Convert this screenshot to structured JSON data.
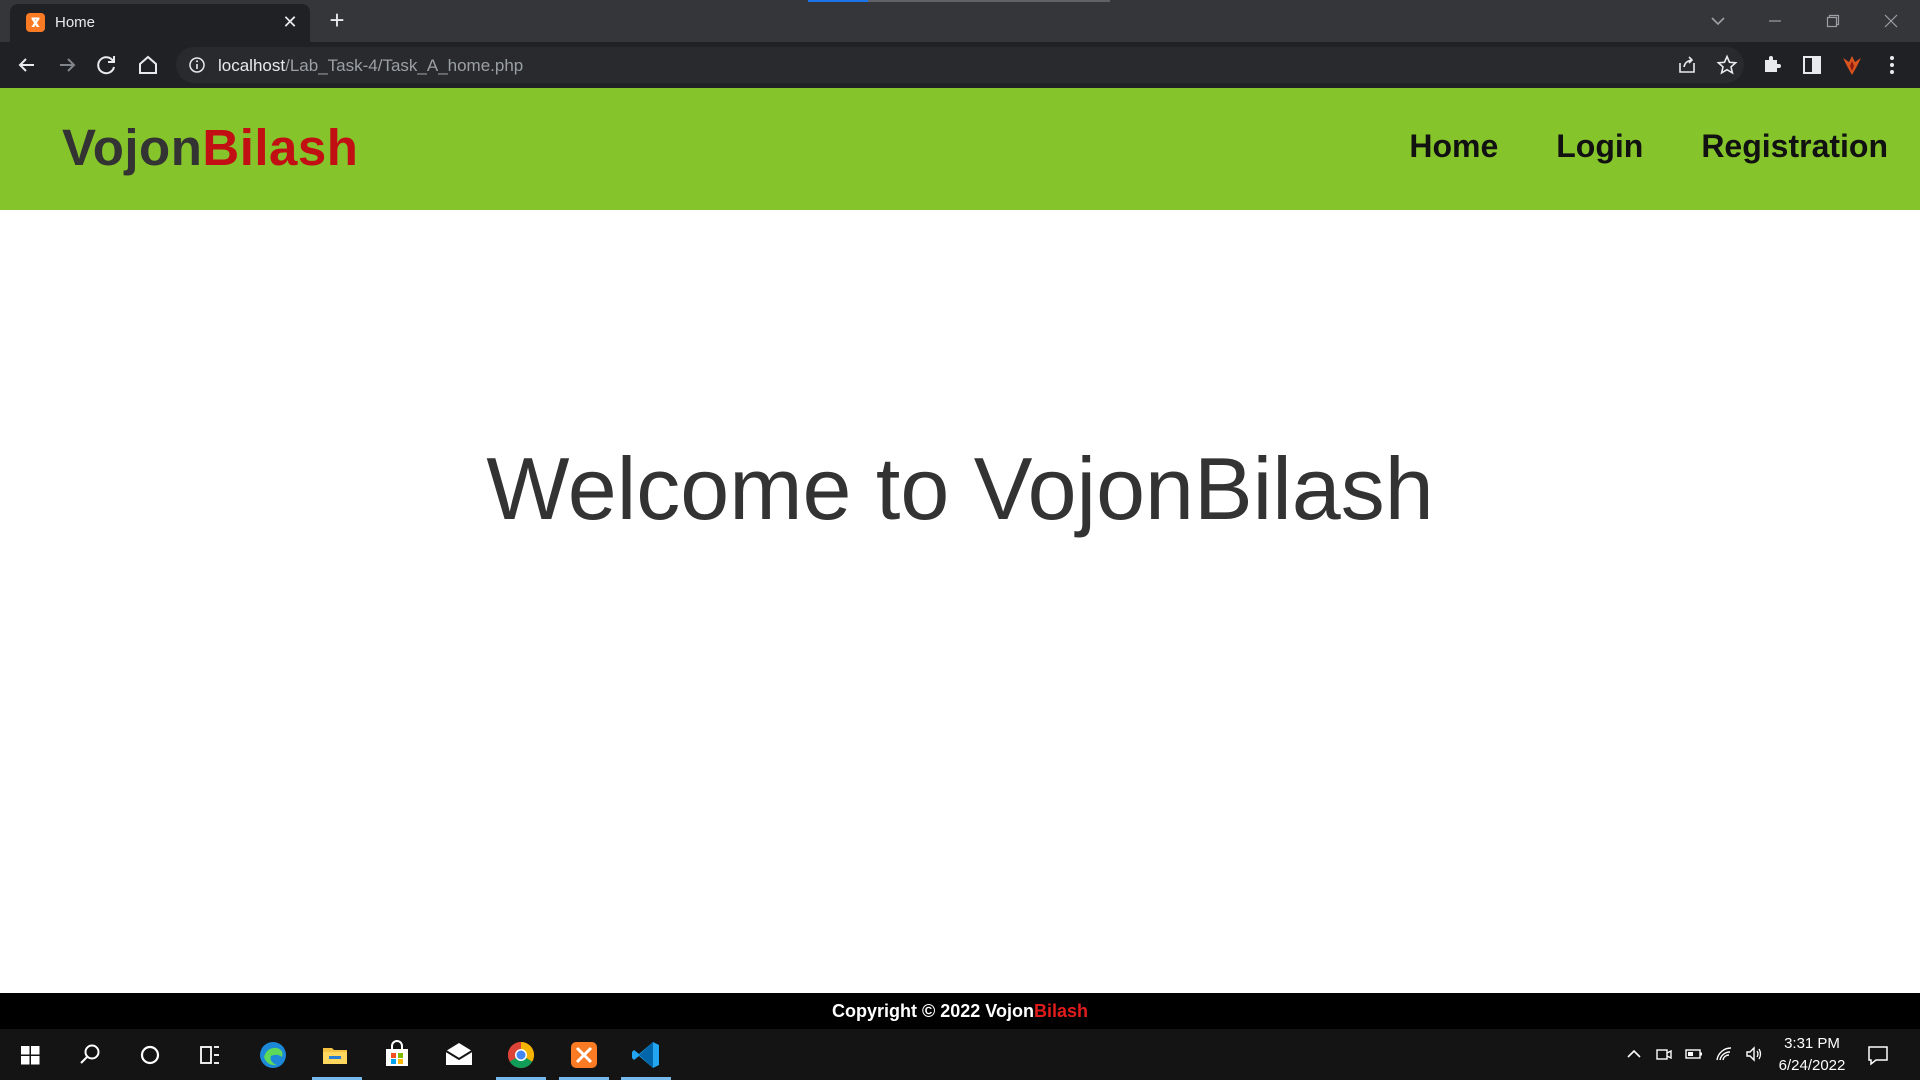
{
  "browser": {
    "tab_title": "Home",
    "new_tab_symbol": "+",
    "url_host": "localhost",
    "url_path": "/Lab_Task-4/Task_A_home.php",
    "window_controls": [
      "minimize",
      "restore",
      "close"
    ]
  },
  "site": {
    "logo_part1": "Vojon",
    "logo_part2": "Bilash",
    "nav": [
      "Home",
      "Login",
      "Registration"
    ],
    "welcome": "Welcome to VojonBilash",
    "footer_prefix": "Copyright © 2022 Vojon",
    "footer_brand": "Bilash",
    "colors": {
      "header_bg": "#86c42c",
      "brand_red": "#c10f13",
      "text_dark": "#333333",
      "footer_bg": "#000000"
    }
  },
  "taskbar": {
    "apps": [
      "windows-start-icon",
      "search-icon",
      "cortana-icon",
      "task-view-icon",
      "edge-icon",
      "file-explorer-icon",
      "microsoft-store-icon",
      "mail-icon",
      "chrome-icon",
      "xampp-icon",
      "vscode-icon"
    ],
    "time": "3:31 PM",
    "date": "6/24/2022"
  }
}
